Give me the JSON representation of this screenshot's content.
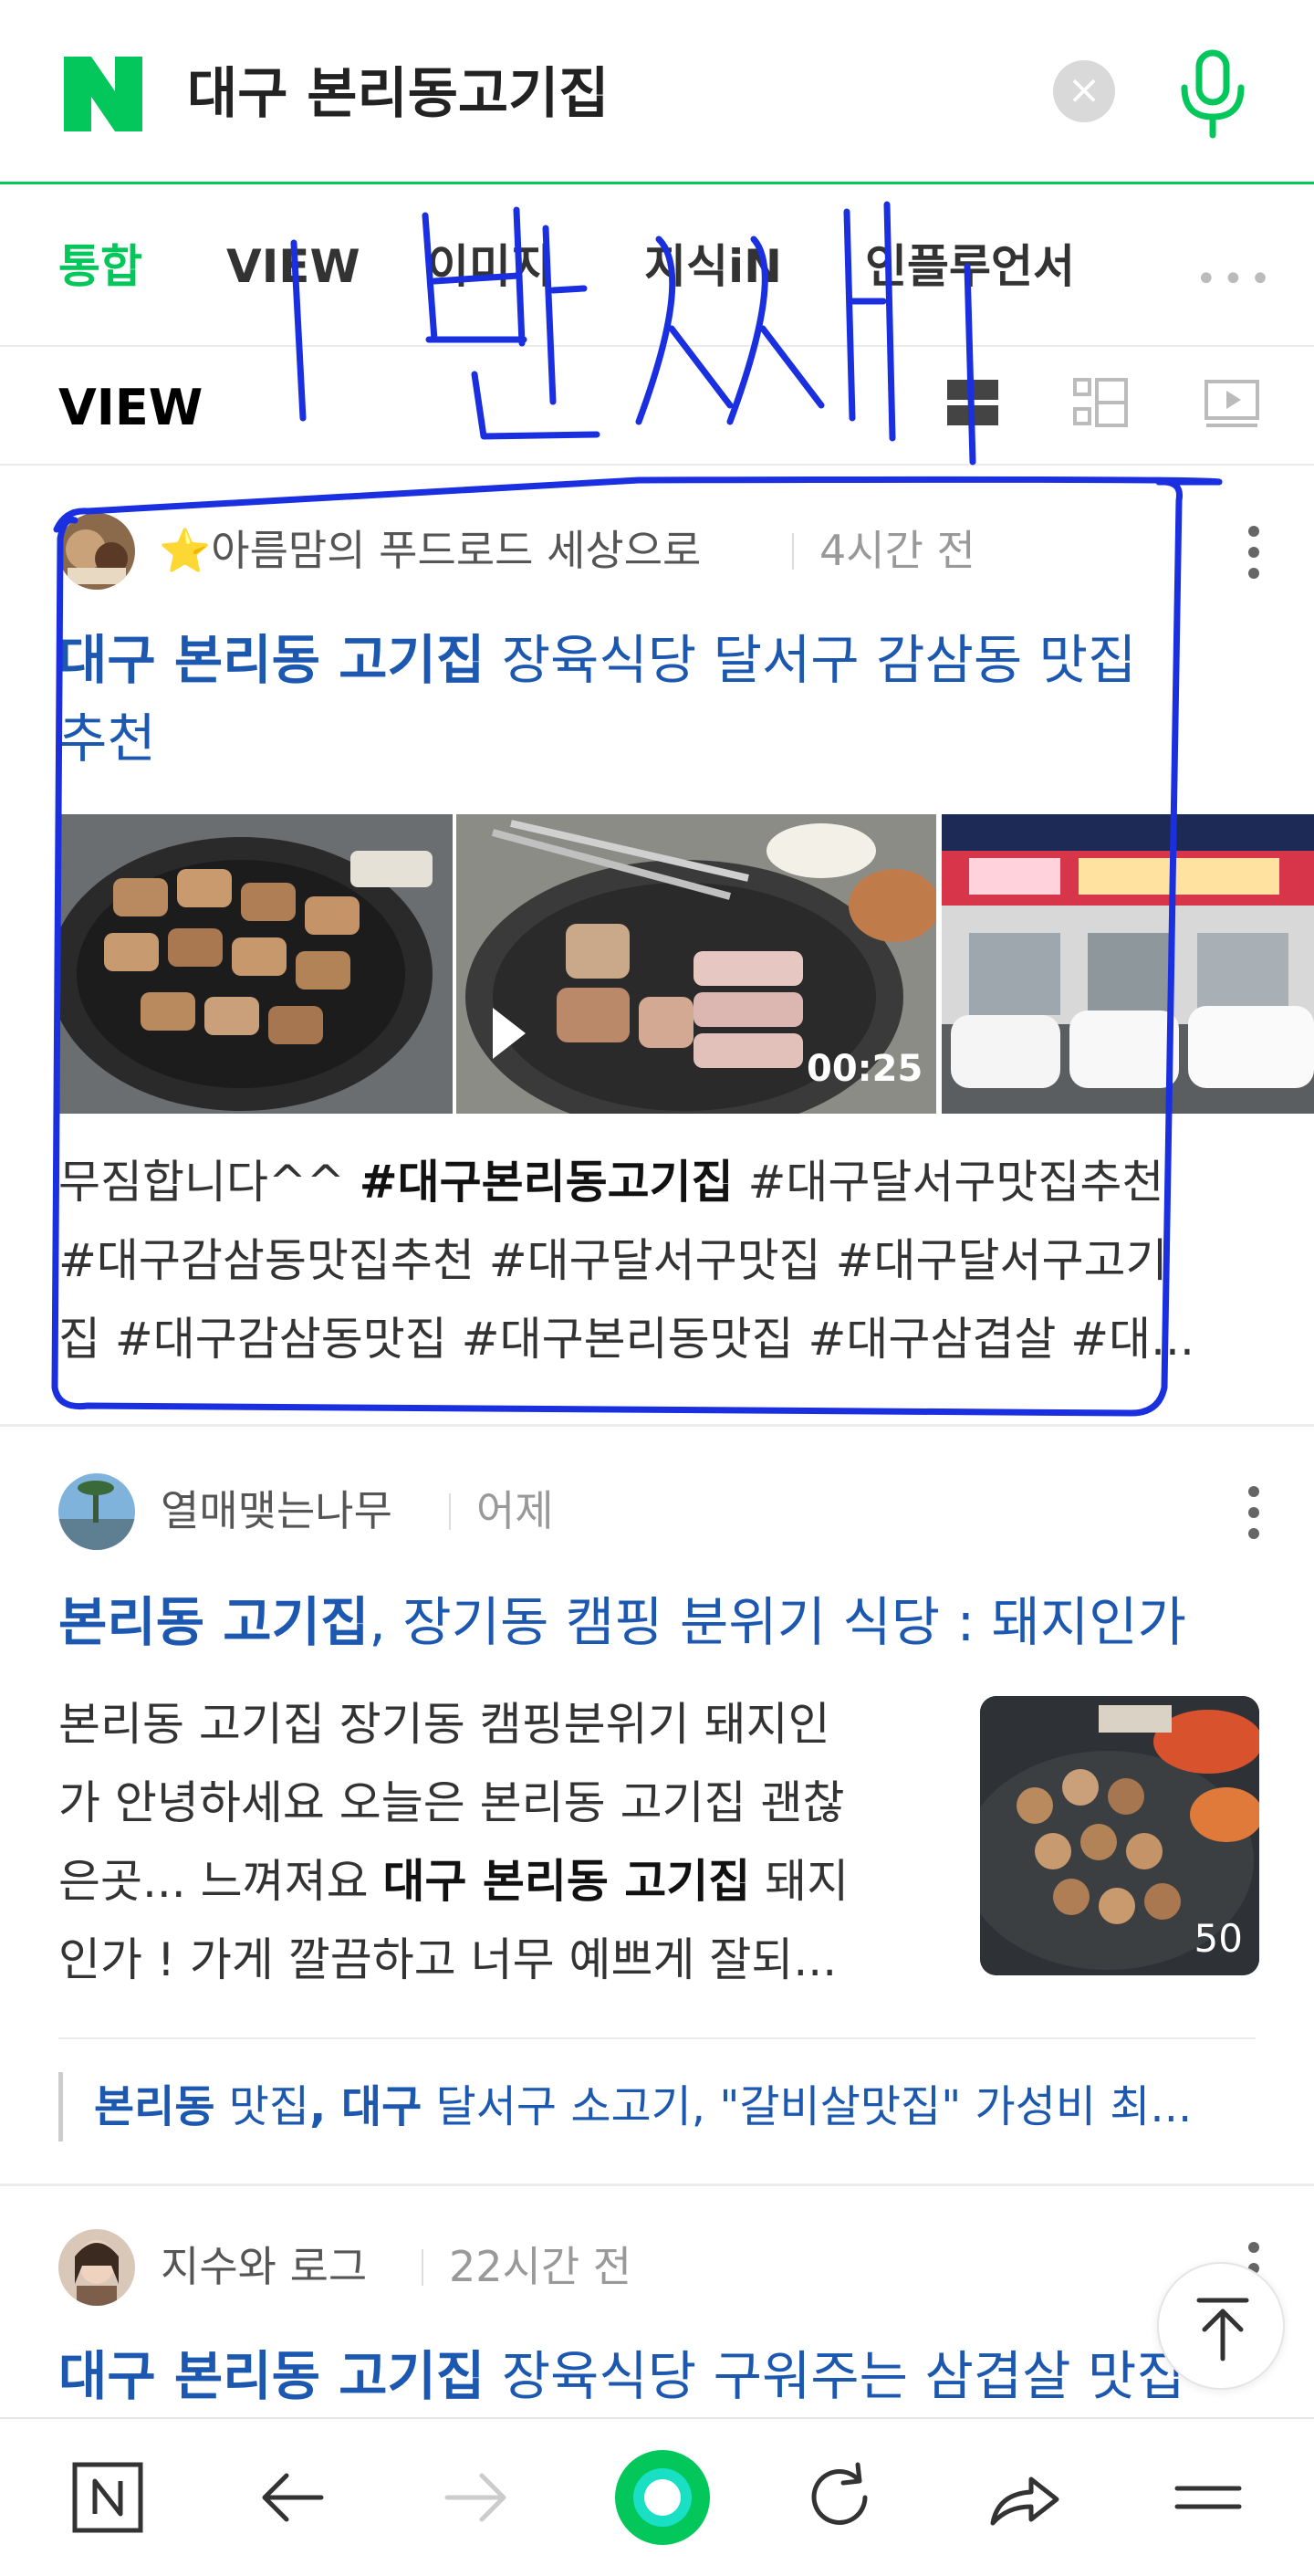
{
  "search": {
    "query": "대구 본리동고기집",
    "clear_glyph": "×"
  },
  "tabs": [
    {
      "label": "통합",
      "active": true
    },
    {
      "label": "VIEW",
      "active": false
    },
    {
      "label": "이미지",
      "active": false
    },
    {
      "label": "지식iN",
      "active": false
    },
    {
      "label": "인플루언서",
      "active": false
    }
  ],
  "tabs_more": "•••",
  "view_section": {
    "title": "VIEW",
    "view_icons": [
      "list-card-icon",
      "list-thumb-icon",
      "video-filter-icon"
    ]
  },
  "annotation_text": "1번째",
  "posts": [
    {
      "author": "⭐아름맘의 푸드로드 세상으로",
      "time": "4시간 전",
      "title_bold": "대구 본리동 고기집",
      "title_rest_line1": " 장육식당 달서구 감삼동 맛집",
      "title_rest_line2": "추천",
      "video_duration": "00:25",
      "snippet_line1_pre": "무짐합니다^^ ",
      "snippet_line1_bold": "#대구본리동고기집",
      "snippet_line1_post": " #대구달서구맛집추천",
      "snippet_line2": "#대구감삼동맛집추천 #대구달서구맛집 #대구달서구고기",
      "snippet_line3": "집 #대구감삼동맛집 #대구본리동맛집 #대구삼겹살 #대..."
    },
    {
      "author": "열매맺는나무",
      "time": "어제",
      "title_bold": "본리동 고기집",
      "title_rest": ", 장기동 캠핑 분위기 식당 : 돼지인가",
      "snippet_line1": "본리동 고기집 장기동 캠핑분위기 돼지인",
      "snippet_line2": "가 안녕하세요 오늘은 본리동 고기집 괜찮",
      "snippet_line3_pre": "은곳... 느껴져요 ",
      "snippet_line3_bold": "대구 본리동 고기집",
      "snippet_line3_post": " 돼지",
      "snippet_line4": "인가 ! 가게 깔끔하고 너무 예쁘게 잘되...",
      "thumb_count": "50",
      "related_b1": "본리동",
      "related_t1": " 맛집",
      "related_b2": ", 대구",
      "related_t2": " 달서구 소고기, \"갈비살맛집\" 가성비 최..."
    },
    {
      "author": "지수와 로그",
      "time": "22시간 전",
      "title_bold": "대구 본리동 고기집",
      "title_rest": " 장육식당 구워주는 삼겹살 맛집"
    }
  ],
  "colors": {
    "naver_green": "#03c75a",
    "link_blue": "#1d58b0",
    "annotation_blue": "#1a2fe0"
  },
  "bottom_nav": [
    "naver-home-icon",
    "back-arrow-icon",
    "forward-arrow-icon",
    "green-dot-icon",
    "refresh-icon",
    "share-icon",
    "menu-icon"
  ]
}
